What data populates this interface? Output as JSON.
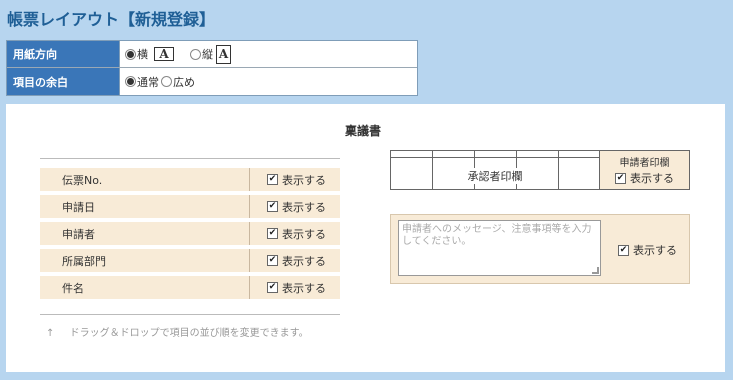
{
  "page": {
    "title": "帳票レイアウト【新規登録】"
  },
  "options": {
    "orientation": {
      "label": "用紙方向",
      "choices": [
        {
          "label": "横",
          "icon": "paper-landscape-icon",
          "icon_letter": "A",
          "selected": true
        },
        {
          "label": "縦",
          "icon": "paper-portrait-icon",
          "icon_letter": "A",
          "selected": false
        }
      ]
    },
    "margin": {
      "label": "項目の余白",
      "choices": [
        {
          "label": "通常",
          "selected": true
        },
        {
          "label": "広め",
          "selected": false
        }
      ]
    }
  },
  "document": {
    "title": "稟議書"
  },
  "fields": [
    {
      "label": "伝票No.",
      "toggle_label": "表示する",
      "checked": true
    },
    {
      "label": "申請日",
      "toggle_label": "表示する",
      "checked": true
    },
    {
      "label": "申請者",
      "toggle_label": "表示する",
      "checked": true
    },
    {
      "label": "所属部門",
      "toggle_label": "表示する",
      "checked": true
    },
    {
      "label": "件名",
      "toggle_label": "表示する",
      "checked": true
    }
  ],
  "hint": {
    "arrow": "↑",
    "text": "ドラッグ＆ドロップで項目の並び順を変更できます。"
  },
  "stamp": {
    "approver_label": "承認者印欄",
    "applicant_label": "申請者印欄",
    "applicant_toggle_label": "表示する",
    "applicant_checked": true
  },
  "message": {
    "placeholder": "申請者へのメッセージ、注意事項等を入力してください。",
    "toggle_label": "表示する",
    "checked": true
  },
  "colors": {
    "background": "#b7d5ef",
    "title": "#1f5f96",
    "label_bg": "#3a76b8",
    "row_bg": "#f8ebd7"
  }
}
